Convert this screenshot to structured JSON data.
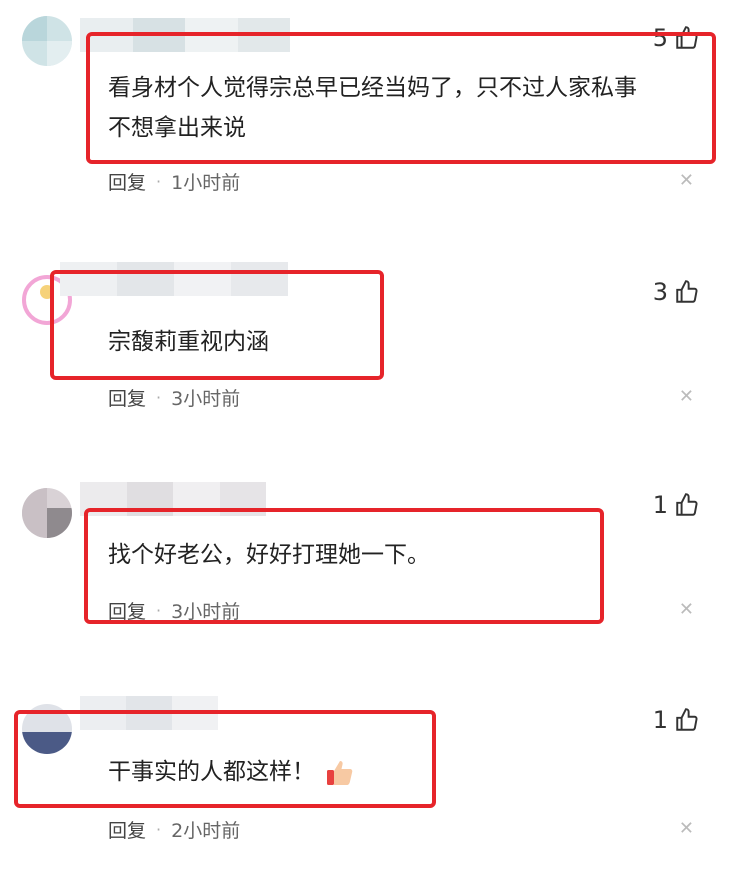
{
  "comments": [
    {
      "likes": "5",
      "text_lines": [
        "看身材个人觉得宗总早已经当妈了，只不过人家私事",
        "不想拿出来说"
      ],
      "reply_label": "回复",
      "time": "1小时前"
    },
    {
      "likes": "3",
      "text_lines": [
        "宗馥莉重视内涵"
      ],
      "reply_label": "回复",
      "time": "3小时前"
    },
    {
      "likes": "1",
      "text_lines": [
        "找个好老公，好好打理她一下。"
      ],
      "reply_label": "回复",
      "time": "3小时前"
    },
    {
      "likes": "1",
      "text_lines": [
        "干事实的人都这样！"
      ],
      "reply_label": "回复",
      "time": "2小时前"
    }
  ],
  "icons": {
    "like": "thumbs-up-icon",
    "close": "close-icon",
    "emoji": "thumbs-up-emoji-icon"
  },
  "colors": {
    "highlight": "#e6242a"
  }
}
